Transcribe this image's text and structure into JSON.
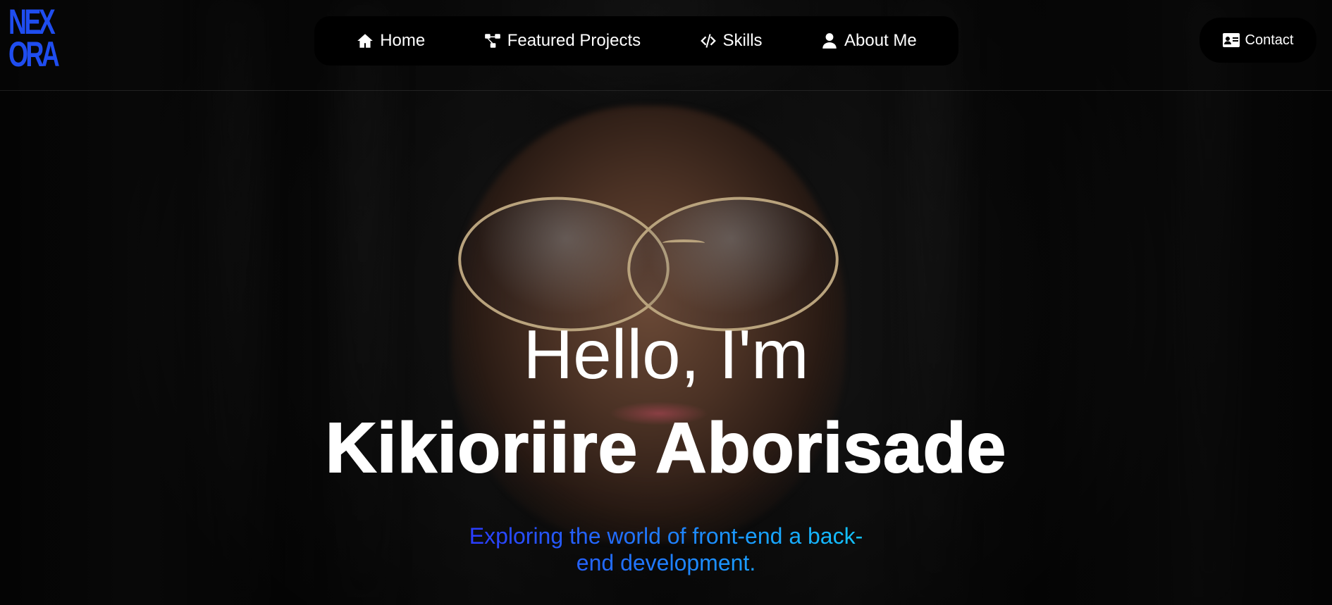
{
  "logo": {
    "line1": "NEX",
    "line2": "ORA",
    "color": "#1f4df0"
  },
  "nav": {
    "items": [
      {
        "label": "Home",
        "icon": "home-icon"
      },
      {
        "label": "Featured Projects",
        "icon": "project-diagram-icon"
      },
      {
        "label": "Skills",
        "icon": "code-icon"
      },
      {
        "label": "About Me",
        "icon": "user-icon"
      }
    ]
  },
  "contact": {
    "label": "Contact",
    "icon": "address-card-icon"
  },
  "hero": {
    "greeting": "Hello, I'm",
    "name": "Kikioriire Aborisade",
    "tagline": "Exploring the world of front-end a back-end development.",
    "tagline_gradient": [
      "#2b3bff",
      "#1f7fff",
      "#12c6ff"
    ]
  }
}
